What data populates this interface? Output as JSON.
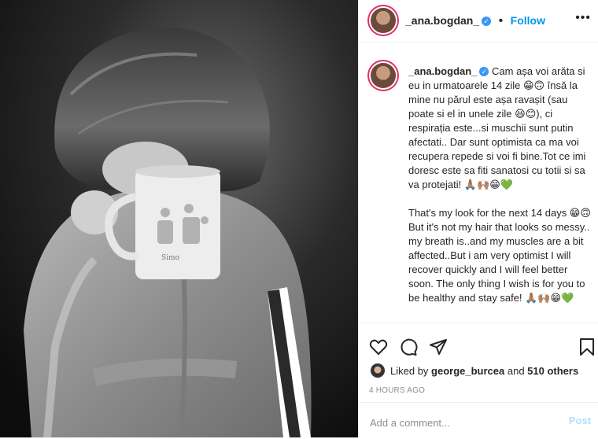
{
  "photo": {
    "mug_text": "Simo"
  },
  "header": {
    "username": "_ana.bogdan_",
    "separator": "•",
    "follow_label": "Follow",
    "more_icon": "more-options-icon"
  },
  "caption": {
    "username": "_ana.bogdan_",
    "text": "Cam așa voi arăta si eu in urmatoarele 14 zile 😁🙃 însă la mine nu părul este așa ravașit (sau poate si el in unele zile 😆😊), ci respirația este...si muschii sunt putin afectati.. Dar sunt optimista ca ma voi recupera repede si voi fi bine.Tot ce imi doresc este sa fiti sanatosi cu totii si sa va protejati! 🙏🏽🙌🏽😁💚\n\nThat's my look for the next 14 days 😁🙃 But it's not my hair that looks so messy.. my breath is..and my muscles are a bit affected..But i am very optimist I will recover quickly and I will feel better soon. The only thing I wish is for you to be healthy and stay safe! 🙏🏽🙌🏽😁💚"
  },
  "actions": {
    "like_icon": "heart-icon",
    "comment_icon": "comment-icon",
    "share_icon": "share-icon",
    "save_icon": "bookmark-icon"
  },
  "likes": {
    "prefix": "Liked by ",
    "user": "george_burcea",
    "middle": " and ",
    "count": "510 others"
  },
  "timestamp": "4 HOURS AGO",
  "comment": {
    "placeholder": "Add a comment...",
    "post_label": "Post"
  },
  "colors": {
    "link_blue": "#0095f6",
    "verified_blue": "#3897f0",
    "post_disabled": "#b2dffc",
    "muted": "#8e8e8e",
    "emoji_green": "#4caf50"
  }
}
